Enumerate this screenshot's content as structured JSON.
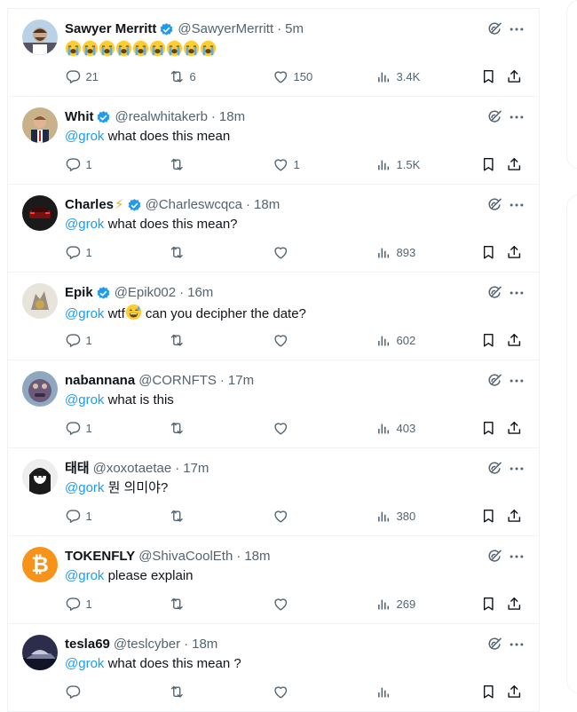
{
  "posts": [
    {
      "name": "Sawyer Merritt",
      "handle": "@SawyerMerritt",
      "time": "5m",
      "verified": true,
      "mention": "",
      "text": "",
      "emoji_count": 9,
      "emoji": "loudly-crying-face",
      "avatar_color": "#c8a98c",
      "replies": "21",
      "reposts": "6",
      "likes": "150",
      "views": "3.4K"
    },
    {
      "name": "Whit",
      "handle": "@realwhitakerb",
      "time": "18m",
      "verified": true,
      "mention": "@grok",
      "text": " what does this mean",
      "avatar_color": "#7d5a3c",
      "replies": "1",
      "reposts": "",
      "likes": "1",
      "views": "1.5K"
    },
    {
      "name": "Charles",
      "handle": "@Charleswcqca",
      "time": "18m",
      "verified": true,
      "bolt": "⚡",
      "mention": "@grok",
      "text": " what does this mean?",
      "avatar_color": "#1a1a1a",
      "replies": "1",
      "reposts": "",
      "likes": "",
      "views": "893"
    },
    {
      "name": "Epik",
      "handle": "@Epik002",
      "time": "16m",
      "verified": true,
      "mention": "@grok",
      "text_before": " wtf",
      "text_after": " can you decipher the date?",
      "emoji": "grinning-sweat-face",
      "avatar_color": "#9a8f80",
      "replies": "1",
      "reposts": "",
      "likes": "",
      "views": "602"
    },
    {
      "name": "nabannana",
      "handle": "@CORNFTS",
      "time": "17m",
      "verified": false,
      "mention": "@grok",
      "text": " what is this",
      "avatar_color": "#6b5a7a",
      "replies": "1",
      "reposts": "",
      "likes": "",
      "views": "403"
    },
    {
      "name": "태태",
      "handle": "@xoxotaetae",
      "time": "17m",
      "verified": false,
      "mention": "@gork",
      "text": " 뭔 의미야?",
      "avatar_color": "#eeeeee",
      "replies": "1",
      "reposts": "",
      "likes": "",
      "views": "380"
    },
    {
      "name": "TOKENFLY",
      "handle": "@ShivaCoolEth",
      "time": "18m",
      "verified": false,
      "mention": "@grok",
      "text": " please explain",
      "avatar_color": "#f7931a",
      "replies": "1",
      "reposts": "",
      "likes": "",
      "views": "269"
    },
    {
      "name": "tesla69",
      "handle": "@teslcyber",
      "time": "18m",
      "verified": false,
      "mention": "@grok",
      "text": " what does this mean ?",
      "avatar_color": "#2b2d4a",
      "replies": "",
      "reposts": "",
      "likes": "",
      "views": ""
    }
  ],
  "separator": "·",
  "accent_color": "#1d9bf0"
}
